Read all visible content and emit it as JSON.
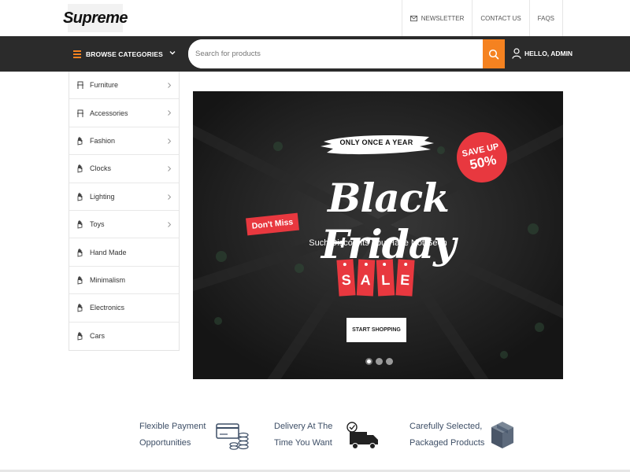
{
  "brand": {
    "logo_text": "Supreme"
  },
  "top_links": [
    {
      "label": "NEWSLETTER",
      "icon": "envelope-icon"
    },
    {
      "label": "CONTACT US"
    },
    {
      "label": "FAQS"
    }
  ],
  "nav": {
    "categories_label": "BROWSE CATEGORIES",
    "search_placeholder": "Search for products",
    "search_value": "",
    "user_label": "HELLO, ADMIN",
    "accent_color": "#f58220",
    "bar_color": "#2b2b2b"
  },
  "sidebar": {
    "items": [
      {
        "label": "Furniture",
        "icon": "chair-icon",
        "has_arrow": true
      },
      {
        "label": "Accessories",
        "icon": "chair-icon",
        "has_arrow": true
      },
      {
        "label": "Fashion",
        "icon": "hand-icon",
        "has_arrow": true
      },
      {
        "label": "Clocks",
        "icon": "hand-icon",
        "has_arrow": true
      },
      {
        "label": "Lighting",
        "icon": "hand-icon",
        "has_arrow": true
      },
      {
        "label": "Toys",
        "icon": "hand-icon",
        "has_arrow": true
      },
      {
        "label": "Hand Made",
        "icon": "hand-icon",
        "has_arrow": false
      },
      {
        "label": "Minimalism",
        "icon": "hand-icon",
        "has_arrow": false
      },
      {
        "label": "Electronics",
        "icon": "hand-icon",
        "has_arrow": false
      },
      {
        "label": "Cars",
        "icon": "hand-icon",
        "has_arrow": false
      }
    ]
  },
  "banner": {
    "tagline": "ONLY ONCE A YEAR",
    "save_line1": "SAVE UP",
    "save_line2": "50%",
    "title": "Black Friday",
    "dont_miss": "Don't Miss",
    "subtitle": "Such Discounts You Have Not Seen",
    "sale_letters": [
      "S",
      "A",
      "L",
      "E"
    ],
    "button_label": "START SHOPPING",
    "slide_count": 3,
    "active_slide": 1,
    "sale_color": "#e8383f"
  },
  "features": [
    {
      "line1": "Flexible Payment",
      "line2": "Opportunities",
      "icon": "payment-icon"
    },
    {
      "line1": "Delivery At The",
      "line2": "Time You Want",
      "icon": "delivery-truck-icon"
    },
    {
      "line1": "Carefully Selected,",
      "line2": "Packaged Products",
      "icon": "package-box-icon"
    }
  ]
}
